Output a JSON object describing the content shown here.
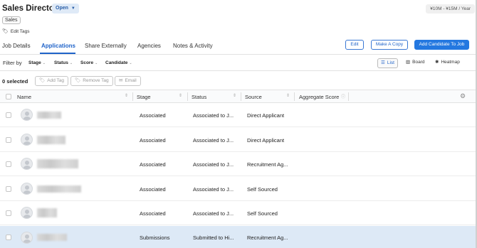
{
  "job": {
    "title": "Sales Director",
    "status": "Open",
    "salary": "¥10M - ¥15M / Year",
    "tag": "Sales",
    "edit_tags_label": "Edit Tags"
  },
  "tabs": [
    "Job Details",
    "Applications",
    "Share Externally",
    "Agencies",
    "Notes & Activity"
  ],
  "active_tab": "Applications",
  "header_buttons": {
    "edit": "Edit",
    "make_copy": "Make A Copy",
    "add_candidate": "Add Candidate To Job"
  },
  "filters": {
    "label": "Filter by",
    "items": [
      "Stage",
      "Status",
      "Score",
      "Candidate"
    ]
  },
  "views": [
    "List",
    "Board",
    "Heatmap"
  ],
  "active_view": "List",
  "selection": {
    "count_label": "0 selected",
    "add_tag": "Add Tag",
    "remove_tag": "Remove Tag",
    "email": "Email"
  },
  "columns": [
    "Name",
    "Stage",
    "Status",
    "Source",
    "Aggregate Score"
  ],
  "rows": [
    {
      "stage": "Associated",
      "status": "Associated to J...",
      "source": "Direct Applicant"
    },
    {
      "stage": "Associated",
      "status": "Associated to J...",
      "source": "Direct Applicant"
    },
    {
      "stage": "Associated",
      "status": "Associated to J...",
      "source": "Recruitment Ag..."
    },
    {
      "stage": "Associated",
      "status": "Associated to J...",
      "source": "Self Sourced"
    },
    {
      "stage": "Associated",
      "status": "Associated to J...",
      "source": "Self Sourced"
    },
    {
      "stage": "Submissions",
      "status": "Submitted to Hi...",
      "source": "Recruitment Ag..."
    }
  ],
  "colors": {
    "accent": "#1f63c9",
    "primary_button": "#2478e0",
    "highlight_row": "#dde9f6"
  }
}
